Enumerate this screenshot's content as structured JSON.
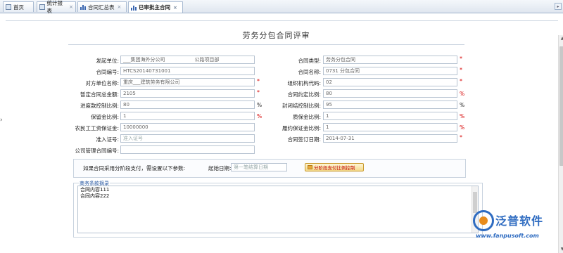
{
  "tabs": [
    {
      "label": "首页",
      "icon": "home-icon"
    },
    {
      "label": "统计报表",
      "icon": "report-icon"
    },
    {
      "label": "合同汇总表",
      "icon": "chart-icon"
    },
    {
      "label": "已审批主合同",
      "icon": "chart-icon"
    }
  ],
  "form": {
    "title": "劳务分包合同评审",
    "fields": {
      "initiator_unit": {
        "label": "发起单位:",
        "value": "___集团海外分公司　　　　　　公路项目部"
      },
      "contract_type": {
        "label": "合同类型:",
        "value": "劳务分包合同"
      },
      "contract_no": {
        "label": "合同编号:",
        "value": "HTCS20140731001"
      },
      "contract_name": {
        "label": "合同名称:",
        "value": "0731 分包合同"
      },
      "counterparty": {
        "label": "对方单位名称:",
        "value": "重庆___建筑劳务有限公司"
      },
      "org_code": {
        "label": "组织机构代码:",
        "value": "02"
      },
      "total_amount": {
        "label": "暂定合同总金额:",
        "value": "2105"
      },
      "agreed_ratio": {
        "label": "合同约定比例:",
        "value": "80"
      },
      "progress_ratio": {
        "label": "进度款控制比例:",
        "value": "80"
      },
      "settle_ratio": {
        "label": "封闭结控制比例:",
        "value": "95"
      },
      "retention_ratio": {
        "label": "保留金比例:",
        "value": "1"
      },
      "warranty_ratio": {
        "label": "质保金比例:",
        "value": "1"
      },
      "wage_deposit": {
        "label": "农民工工资保证金:",
        "value": "10000000"
      },
      "performance_ratio": {
        "label": "履约保证金比例:",
        "value": "1"
      },
      "access_cert": {
        "label": "准入证号:",
        "placeholder": "准入证号"
      },
      "sign_date": {
        "label": "合同签订日期:",
        "value": "2014-07-31"
      },
      "company_mgmt_no": {
        "label": "公司管理合同编号:",
        "value": ""
      }
    },
    "required_mark": "*",
    "percent_mark": "%",
    "installment": {
      "prompt": "如果合同采用分阶段支付，需设置以下参数:",
      "start_date_label": "起始日期:",
      "start_date_placeholder": "第一笔结算日期",
      "button_label": "分阶段支付比例控制"
    },
    "clauses": {
      "legend": "商务条款摘录",
      "lines": [
        "合同内容111",
        "合同内容222"
      ]
    }
  },
  "brand": {
    "name": "泛普软件",
    "url": "www.fanpusoft.com",
    "colors": {
      "primary": "#2f6cc1",
      "accent": "#e88c1d"
    }
  },
  "colors": {
    "required": "#d60000",
    "legend": "#2a5aa3"
  }
}
